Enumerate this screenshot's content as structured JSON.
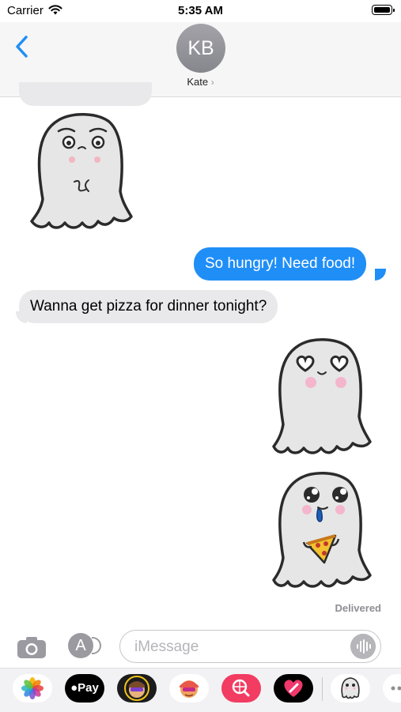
{
  "status_bar": {
    "carrier": "Carrier",
    "time": "5:35 AM"
  },
  "header": {
    "avatar_initials": "KB",
    "contact_name": "Kate",
    "contact_chevron": "›"
  },
  "messages": [
    {
      "side": "received",
      "type": "text-partial",
      "text": ""
    },
    {
      "side": "received",
      "type": "sticker",
      "sticker": "ghost-worried"
    },
    {
      "side": "sent",
      "type": "text",
      "text": "So hungry! Need food!"
    },
    {
      "side": "received",
      "type": "text",
      "text": "Wanna get pizza for dinner tonight?"
    },
    {
      "side": "sent",
      "type": "sticker",
      "sticker": "ghost-heart-eyes"
    },
    {
      "side": "sent",
      "type": "sticker",
      "sticker": "ghost-pizza-drool"
    }
  ],
  "delivered_label": "Delivered",
  "input": {
    "placeholder": "iMessage",
    "value": ""
  },
  "apps": {
    "applepay_label": "Pay",
    "items": [
      "photos-icon",
      "apple-pay-icon",
      "memoji-icon",
      "memoji-stickers-icon",
      "image-search-icon",
      "digital-touch-icon",
      "ghost-sticker-pack-icon",
      "more-apps-icon"
    ]
  },
  "colors": {
    "sent_bubble": "#1f8ef7",
    "received_bubble": "#e9e9eb",
    "accent": "#1f8ef7"
  }
}
